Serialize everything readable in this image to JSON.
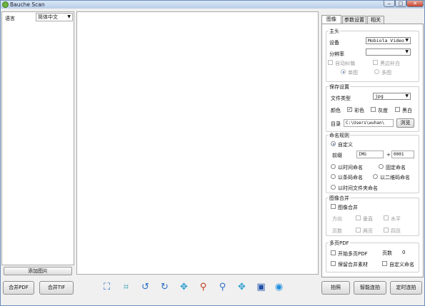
{
  "window": {
    "title": "Bauche Scan",
    "min": "‒",
    "max": "□",
    "close": "✕"
  },
  "left": {
    "lang_label": "语言",
    "lang_value": "简体中文",
    "add_button": "添加图片"
  },
  "bottom_left": {
    "merge_pdf": "合并PDF",
    "merge_tif": "合并TIF"
  },
  "toolbar": [
    {
      "name": "select-area-icon",
      "glyph": "⛶",
      "color": "#2f6fc8"
    },
    {
      "name": "crop-icon",
      "glyph": "⌗",
      "color": "#2f9fb0"
    },
    {
      "name": "rotate-left-icon",
      "glyph": "↺",
      "color": "#2f6fc8"
    },
    {
      "name": "rotate-right-icon",
      "glyph": "↻",
      "color": "#2f6fc8"
    },
    {
      "name": "move-icon",
      "glyph": "✥",
      "color": "#2f9fd0"
    },
    {
      "name": "zoom-in-icon",
      "glyph": "⚲",
      "color": "#c04020"
    },
    {
      "name": "zoom-out-icon",
      "glyph": "⚲",
      "color": "#2f6fc8"
    },
    {
      "name": "fit-icon",
      "glyph": "✥",
      "color": "#2f9fd0"
    },
    {
      "name": "film-icon",
      "glyph": "▣",
      "color": "#1f4fa8"
    },
    {
      "name": "view-icon",
      "glyph": "◉",
      "color": "#1f8fe0"
    }
  ],
  "tabs": [
    "图像",
    "参数设置",
    "相关"
  ],
  "panel": {
    "main_group": "主头",
    "device_label": "设备",
    "device_value": "Mobiola Video",
    "resolution_label": "分辨率",
    "resolution_value": "",
    "auto_crop": "自动纠偏",
    "remove_black": "黑边补白",
    "single": "单图",
    "multi": "多图",
    "save_group": "保存设置",
    "file_type_label": "文件类型",
    "file_type_value": "jpg",
    "color_label": "颜色",
    "color_color": "彩色",
    "color_gray": "灰度",
    "color_bw": "黑白",
    "dir_label": "目录",
    "dir_value": "C:\\Users\\wuhan\\",
    "browse": "浏览",
    "naming_group": "命名规则",
    "custom": "自定义",
    "prefix_label": "前缀",
    "prefix_value": "IMG",
    "plus": "+",
    "number_value": "0001",
    "by_time": "以时间命名",
    "fixed": "固定命名",
    "by_barcode": "以条码命名",
    "by_qrcode": "以二维码命名",
    "by_folder": "以时间文件夹命名",
    "merge_group": "图像合并",
    "merge_image": "图像合并",
    "direction_label": "方向",
    "vertical": "垂直",
    "horizontal": "水平",
    "pages_label": "页数",
    "two_pages": "两页",
    "four_pages": "四页",
    "multipdf_group": "多页PDF",
    "start_multipdf": "开始多页PDF",
    "pages_count_label": "页数",
    "pages_count": "0",
    "keep_merged": "保留合并素材",
    "custom_name": "自定义命名"
  },
  "bottom_right": {
    "shoot": "拍照",
    "smart_shoot": "智能连拍",
    "timed_shoot": "定时连拍"
  }
}
